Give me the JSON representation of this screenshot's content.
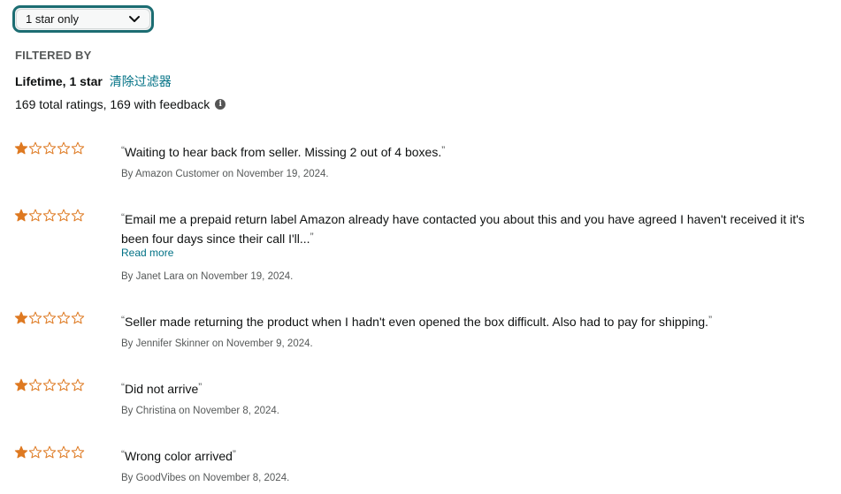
{
  "filter": {
    "dropdown_value": "1 star only",
    "filtered_by_label": "FILTERED BY",
    "filter_name": "Lifetime, 1 star",
    "clear_link": "清除过滤器",
    "totals": "169 total ratings, 169 with feedback",
    "info_icon": "info-icon"
  },
  "colors": {
    "accent_teal": "#1c6d72",
    "link": "#007185",
    "star_fill": "#de7921",
    "star_outline": "#de7921"
  },
  "reviews": [
    {
      "rating": 1,
      "text": "Waiting to hear back from seller. Missing 2 out of 4 boxes.",
      "byline": "By Amazon Customer on November 19, 2024.",
      "read_more": ""
    },
    {
      "rating": 1,
      "text": "Email me a prepaid return label Amazon already have contacted you about this and you have agreed I haven't received it it's been four days since their call I'll...",
      "byline": "By Janet Lara on November 19, 2024.",
      "read_more": "Read more"
    },
    {
      "rating": 1,
      "text": "Seller made returning the product when I hadn't even opened the box difficult. Also had to pay for shipping.",
      "byline": "By Jennifer Skinner on November 9, 2024.",
      "read_more": ""
    },
    {
      "rating": 1,
      "text": "Did not arrive",
      "byline": "By Christina on November 8, 2024.",
      "read_more": ""
    },
    {
      "rating": 1,
      "text": "Wrong color arrived",
      "byline": "By GoodVibes on November 8, 2024.",
      "read_more": ""
    }
  ]
}
